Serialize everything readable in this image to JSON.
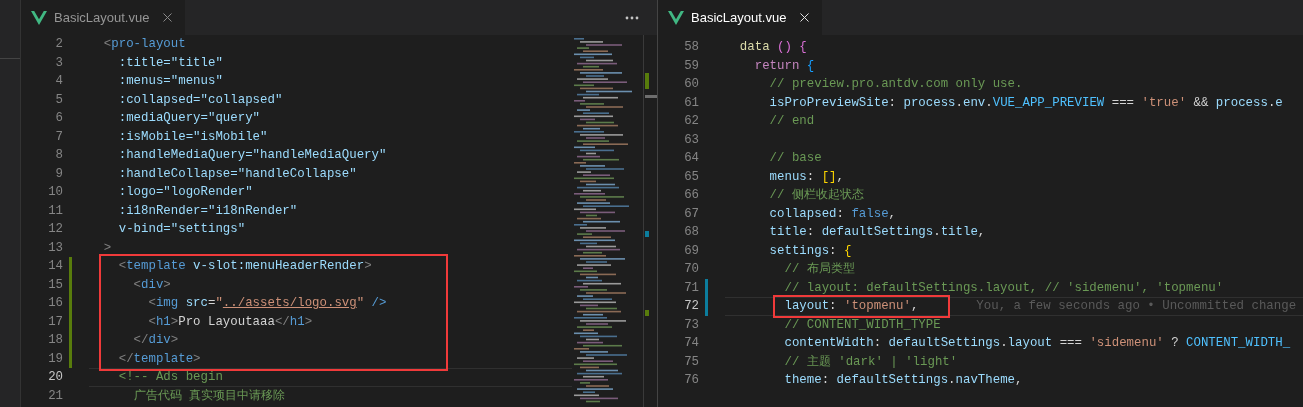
{
  "panes": [
    {
      "focused": false,
      "tabs": [
        {
          "label": "BasicLayout.vue",
          "selected": true
        }
      ],
      "lines": [
        {
          "number": "2",
          "tokens": [
            {
              "kind": "punct",
              "text": "<"
            },
            {
              "kind": "tag",
              "text": "pro-layout"
            }
          ],
          "children": [
            {
              "number": "3",
              "tokens": [
                {
                  "kind": "attr",
                  "text": ":title=\"title\""
                }
              ]
            },
            {
              "number": "4",
              "tokens": [
                {
                  "kind": "attr",
                  "text": ":menus=\"menus\""
                }
              ]
            },
            {
              "number": "5",
              "tokens": [
                {
                  "kind": "attr",
                  "text": ":collapsed=\"collapsed\""
                }
              ]
            },
            {
              "number": "6",
              "tokens": [
                {
                  "kind": "attr",
                  "text": ":mediaQuery=\"query\""
                }
              ]
            },
            {
              "number": "7",
              "tokens": [
                {
                  "kind": "attr",
                  "text": ":isMobile=\"isMobile\""
                }
              ]
            },
            {
              "number": "8",
              "tokens": [
                {
                  "kind": "attr",
                  "text": ":handleMediaQuery=\"handleMediaQuery\""
                }
              ]
            },
            {
              "number": "9",
              "tokens": [
                {
                  "kind": "attr",
                  "text": ":handleCollapse=\"handleCollapse\""
                }
              ]
            },
            {
              "number": "10",
              "tokens": [
                {
                  "kind": "attr",
                  "text": ":logo=\"logoRender\""
                }
              ]
            },
            {
              "number": "11",
              "tokens": [
                {
                  "kind": "attr",
                  "text": ":i18nRender=\"i18nRender\""
                }
              ]
            },
            {
              "number": "12",
              "tokens": [
                {
                  "kind": "attr",
                  "text": "v-bind=\"settings\""
                }
              ]
            }
          ]
        },
        {
          "number": "13",
          "tokens": [
            {
              "kind": "punct",
              "text": ">"
            }
          ],
          "children": [
            {
              "number": "14",
              "added": true,
              "boxed": true,
              "tokens": [
                {
                  "kind": "punct",
                  "text": "<"
                },
                {
                  "kind": "tag",
                  "text": "template"
                },
                {
                  "kind": "attr",
                  "text": " v-slot:menuHeaderRender"
                },
                {
                  "kind": "punct",
                  "text": ">"
                }
              ],
              "children": [
                {
                  "number": "15",
                  "added": true,
                  "boxed": true,
                  "tokens": [
                    {
                      "kind": "punct",
                      "text": "<"
                    },
                    {
                      "kind": "tag",
                      "text": "div"
                    },
                    {
                      "kind": "punct",
                      "text": ">"
                    }
                  ],
                  "children": [
                    {
                      "number": "16",
                      "added": true,
                      "boxed": true,
                      "tokens": [
                        {
                          "kind": "punct",
                          "text": "<"
                        },
                        {
                          "kind": "tag",
                          "text": "img"
                        },
                        {
                          "kind": "attr",
                          "text": " src"
                        },
                        {
                          "kind": "text",
                          "text": "="
                        },
                        {
                          "kind": "string",
                          "text": "\""
                        },
                        {
                          "kind": "link",
                          "text": "../assets/logo.svg"
                        },
                        {
                          "kind": "string",
                          "text": "\""
                        },
                        {
                          "kind": "tag",
                          "text": " />"
                        }
                      ]
                    },
                    {
                      "number": "17",
                      "added": true,
                      "boxed": true,
                      "tokens": [
                        {
                          "kind": "punct",
                          "text": "<"
                        },
                        {
                          "kind": "tag",
                          "text": "h1"
                        },
                        {
                          "kind": "punct",
                          "text": ">"
                        },
                        {
                          "kind": "text",
                          "text": "Pro Layoutaaa"
                        },
                        {
                          "kind": "punct",
                          "text": "</"
                        },
                        {
                          "kind": "tag",
                          "text": "h1"
                        },
                        {
                          "kind": "punct",
                          "text": ">"
                        }
                      ]
                    }
                  ]
                },
                {
                  "number": "18",
                  "added": true,
                  "boxed": true,
                  "tokens": [
                    {
                      "kind": "punct",
                      "text": "</"
                    },
                    {
                      "kind": "tag",
                      "text": "div"
                    },
                    {
                      "kind": "punct",
                      "text": ">"
                    }
                  ]
                }
              ]
            },
            {
              "number": "19",
              "added": true,
              "boxed": true,
              "tokens": [
                {
                  "kind": "punct",
                  "text": "</"
                },
                {
                  "kind": "tag",
                  "text": "template"
                },
                {
                  "kind": "punct",
                  "text": ">"
                }
              ]
            },
            {
              "number": "20",
              "current": true,
              "tokens": [
                {
                  "kind": "comment",
                  "text": "<!-- Ads begin"
                }
              ],
              "children": [
                {
                  "number": "21",
                  "tokens": [
                    {
                      "kind": "comment",
                      "text": "广告代码 真实项目中请移除"
                    }
                  ]
                }
              ]
            }
          ]
        }
      ]
    },
    {
      "focused": true,
      "tabs": [
        {
          "label": "BasicLayout.vue",
          "selected": true
        }
      ],
      "lines": [
        {
          "number": "58",
          "tokens": [
            {
              "kind": "func",
              "text": "data"
            },
            {
              "kind": "bracket2",
              "text": " ()"
            },
            {
              "kind": "bracket2",
              "text": " {"
            }
          ],
          "children": [
            {
              "number": "59",
              "tokens": [
                {
                  "kind": "keyword",
                  "text": "return"
                },
                {
                  "kind": "bracket3",
                  "text": " {"
                }
              ],
              "children": [
                {
                  "number": "60",
                  "tokens": [
                    {
                      "kind": "comment",
                      "text": "// preview.pro.antdv.com only use."
                    }
                  ]
                },
                {
                  "number": "61",
                  "tokens": [
                    {
                      "kind": "var",
                      "text": "isProPreviewSite"
                    },
                    {
                      "kind": "text",
                      "text": ": "
                    },
                    {
                      "kind": "var",
                      "text": "process"
                    },
                    {
                      "kind": "text",
                      "text": "."
                    },
                    {
                      "kind": "var",
                      "text": "env"
                    },
                    {
                      "kind": "text",
                      "text": "."
                    },
                    {
                      "kind": "const",
                      "text": "VUE_APP_PREVIEW"
                    },
                    {
                      "kind": "text",
                      "text": " === "
                    },
                    {
                      "kind": "string",
                      "text": "'true'"
                    },
                    {
                      "kind": "text",
                      "text": " && "
                    },
                    {
                      "kind": "var",
                      "text": "process"
                    },
                    {
                      "kind": "text",
                      "text": "."
                    },
                    {
                      "kind": "var",
                      "text": "e"
                    }
                  ]
                },
                {
                  "number": "62",
                  "tokens": [
                    {
                      "kind": "comment",
                      "text": "// end"
                    }
                  ]
                },
                {
                  "number": "63"
                },
                {
                  "number": "64",
                  "tokens": [
                    {
                      "kind": "comment",
                      "text": "// base"
                    }
                  ]
                },
                {
                  "number": "65",
                  "tokens": [
                    {
                      "kind": "var",
                      "text": "menus"
                    },
                    {
                      "kind": "text",
                      "text": ": "
                    },
                    {
                      "kind": "bracket1",
                      "text": "[]"
                    },
                    {
                      "kind": "text",
                      "text": ","
                    }
                  ]
                },
                {
                  "number": "66",
                  "tokens": [
                    {
                      "kind": "comment",
                      "text": "// 侧栏收起状态"
                    }
                  ]
                },
                {
                  "number": "67",
                  "tokens": [
                    {
                      "kind": "var",
                      "text": "collapsed"
                    },
                    {
                      "kind": "text",
                      "text": ": "
                    },
                    {
                      "kind": "bool",
                      "text": "false"
                    },
                    {
                      "kind": "text",
                      "text": ","
                    }
                  ]
                },
                {
                  "number": "68",
                  "tokens": [
                    {
                      "kind": "var",
                      "text": "title"
                    },
                    {
                      "kind": "text",
                      "text": ": "
                    },
                    {
                      "kind": "var",
                      "text": "defaultSettings"
                    },
                    {
                      "kind": "text",
                      "text": "."
                    },
                    {
                      "kind": "var",
                      "text": "title"
                    },
                    {
                      "kind": "text",
                      "text": ","
                    }
                  ]
                },
                {
                  "number": "69",
                  "tokens": [
                    {
                      "kind": "var",
                      "text": "settings"
                    },
                    {
                      "kind": "text",
                      "text": ": "
                    },
                    {
                      "kind": "bracket1",
                      "text": "{"
                    }
                  ],
                  "children": [
                    {
                      "number": "70",
                      "tokens": [
                        {
                          "kind": "comment",
                          "text": "// 布局类型"
                        }
                      ]
                    },
                    {
                      "number": "71",
                      "modified": true,
                      "tokens": [
                        {
                          "kind": "comment",
                          "text": "// layout: defaultSettings.layout, // 'sidemenu', 'topmenu'"
                        }
                      ]
                    },
                    {
                      "number": "72",
                      "modified": true,
                      "current": true,
                      "boxed": true,
                      "blame": "You, a few seconds ago • Uncommitted change",
                      "tokens": [
                        {
                          "kind": "var",
                          "text": "layout"
                        },
                        {
                          "kind": "text",
                          "text": ": "
                        },
                        {
                          "kind": "string",
                          "text": "'topmenu'"
                        },
                        {
                          "kind": "text",
                          "text": ","
                        }
                      ]
                    },
                    {
                      "number": "73",
                      "tokens": [
                        {
                          "kind": "comment",
                          "text": "// CONTENT_WIDTH_TYPE"
                        }
                      ]
                    },
                    {
                      "number": "74",
                      "tokens": [
                        {
                          "kind": "var",
                          "text": "contentWidth"
                        },
                        {
                          "kind": "text",
                          "text": ": "
                        },
                        {
                          "kind": "var",
                          "text": "defaultSettings"
                        },
                        {
                          "kind": "text",
                          "text": "."
                        },
                        {
                          "kind": "var",
                          "text": "layout"
                        },
                        {
                          "kind": "text",
                          "text": " === "
                        },
                        {
                          "kind": "string",
                          "text": "'sidemenu'"
                        },
                        {
                          "kind": "text",
                          "text": " ? "
                        },
                        {
                          "kind": "const",
                          "text": "CONTENT_WIDTH_"
                        }
                      ]
                    },
                    {
                      "number": "75",
                      "tokens": [
                        {
                          "kind": "comment",
                          "text": "// 主题 'dark' | 'light'"
                        }
                      ]
                    },
                    {
                      "number": "76",
                      "tokens": [
                        {
                          "kind": "var",
                          "text": "theme"
                        },
                        {
                          "kind": "text",
                          "text": ": "
                        },
                        {
                          "kind": "var",
                          "text": "defaultSettings"
                        },
                        {
                          "kind": "text",
                          "text": "."
                        },
                        {
                          "kind": "var",
                          "text": "navTheme"
                        },
                        {
                          "kind": "text",
                          "text": ","
                        }
                      ]
                    }
                  ]
                }
              ]
            }
          ]
        }
      ]
    }
  ]
}
